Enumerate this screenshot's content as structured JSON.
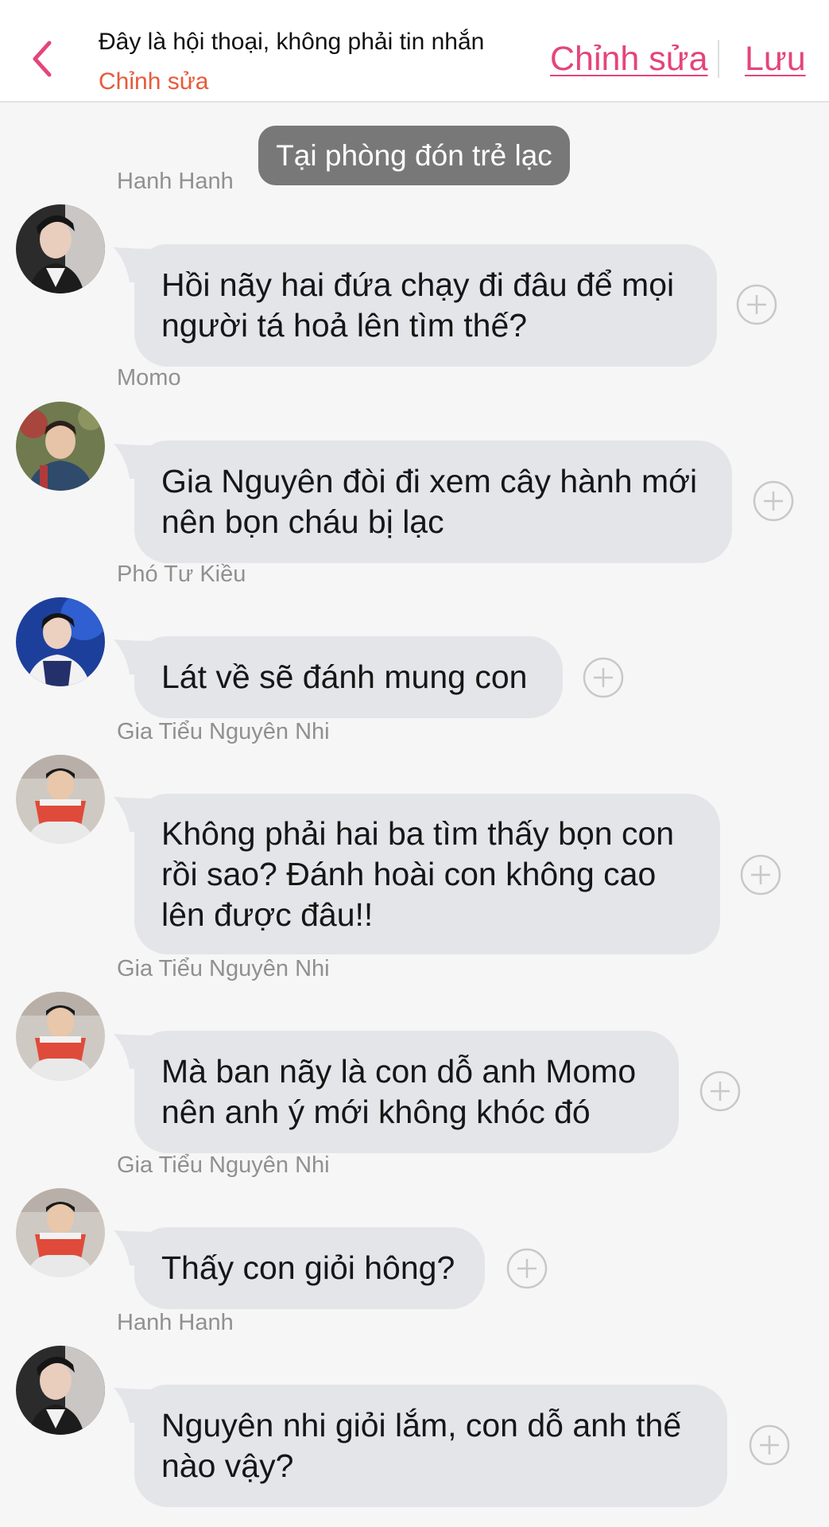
{
  "header": {
    "title": "Đây là hội thoại, không phải tin nhắn",
    "subtitle": "Chỉnh sửa",
    "edit_label": "Chỉnh sửa",
    "save_label": "Lưu"
  },
  "scene": {
    "label": "Tại phòng đón trẻ lạc"
  },
  "messages": [
    {
      "sender": "Hanh Hanh",
      "text": "Hồi nãy hai đứa chạy đi đâu để mọi\nngười tá hoả lên tìm thế?"
    },
    {
      "sender": "Momo",
      "text": "Gia Nguyên đòi đi xem cây hành mới\nnên bọn cháu bị lạc"
    },
    {
      "sender": "Phó Tư Kiều",
      "text": "Lát về sẽ đánh mung con"
    },
    {
      "sender": "Gia Tiểu Nguyên Nhi",
      "text": "Không phải hai ba tìm thấy bọn con\nrồi sao? Đánh hoài con không cao\nlên được đâu!!"
    },
    {
      "sender": "Gia Tiểu Nguyên Nhi",
      "text": "Mà ban nãy là con dỗ anh Momo\nnên anh ý mới không khóc đó"
    },
    {
      "sender": "Gia Tiểu Nguyên Nhi",
      "text": "Thấy con giỏi hông?"
    },
    {
      "sender": "Hanh Hanh",
      "text": "Nguyên nhi giỏi lắm, con dỗ anh thế\nnào vậy?"
    }
  ],
  "colors": {
    "accent": "#e4457a",
    "subtitle": "#e85a3a",
    "bubble": "#e4e5e9",
    "scene_badge": "#787878",
    "background": "#f6f6f6"
  },
  "icons": {
    "back": "chevron-left-icon",
    "add": "plus-circle-icon",
    "avatar": "avatar"
  }
}
